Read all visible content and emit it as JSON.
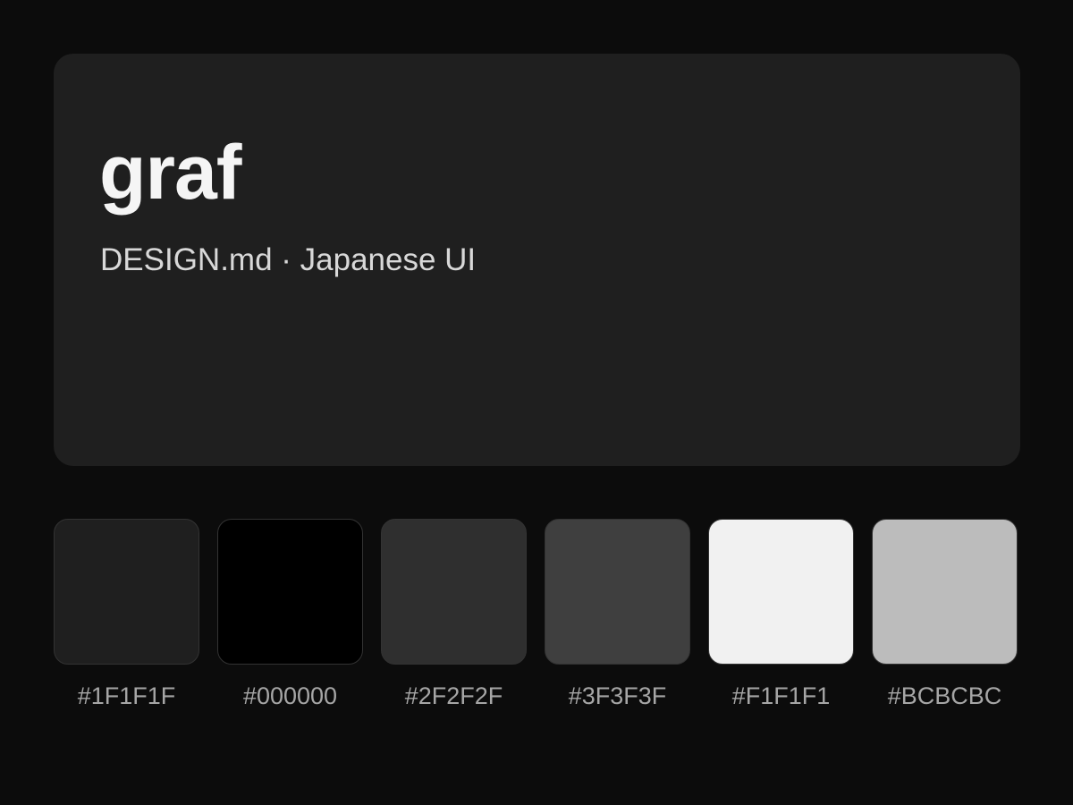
{
  "hero": {
    "title": "graf",
    "subtitle": "DESIGN.md · Japanese UI",
    "background": "#1F1F1F",
    "title_color": "#F5F5F5",
    "subtitle_color": "#D8D8D8"
  },
  "page": {
    "background": "#0C0C0C"
  },
  "swatches": [
    {
      "hex": "#1F1F1F",
      "label": "#1F1F1F"
    },
    {
      "hex": "#000000",
      "label": "#000000"
    },
    {
      "hex": "#2F2F2F",
      "label": "#2F2F2F"
    },
    {
      "hex": "#3F3F3F",
      "label": "#3F3F3F"
    },
    {
      "hex": "#F1F1F1",
      "label": "#F1F1F1"
    },
    {
      "hex": "#BCBCBC",
      "label": "#BCBCBC"
    }
  ]
}
